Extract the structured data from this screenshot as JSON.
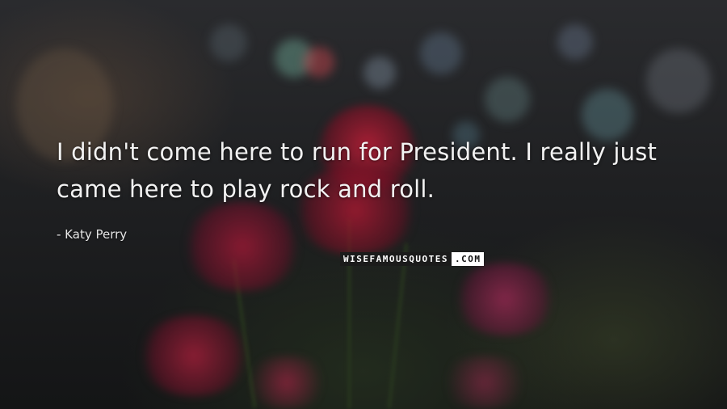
{
  "quote": {
    "line1": "I didn't come here to run for President. I really just",
    "line2": "came here to play rock and roll."
  },
  "author": "- Katy Perry",
  "watermark": {
    "part1": "WISEFAMOUSQUOTES",
    "part2": ".COM"
  }
}
